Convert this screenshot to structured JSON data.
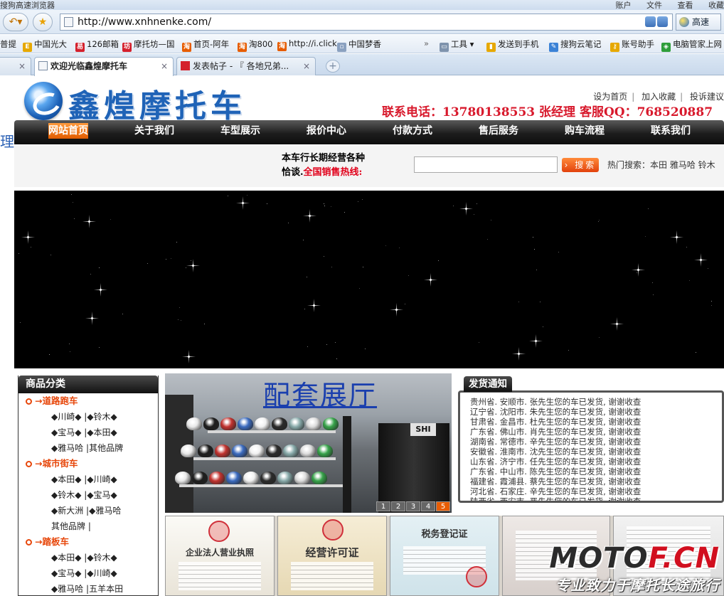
{
  "browser": {
    "title": "搜狗高速浏览器",
    "menu": [
      "账户",
      "文件",
      "查看",
      "收藏"
    ],
    "address": "http://www.xnhnenke.com/",
    "fast_label": "高速",
    "bookmarks": [
      "普提",
      "中国光大",
      "126邮箱",
      "摩托坊—国",
      "首页-阿年",
      "淘800",
      "http://i.click",
      "中国梦香"
    ],
    "bookmarks_right": [
      "工具",
      "发送到手机",
      "搜狗云笔记",
      "账号助手",
      "电脑管家上网"
    ],
    "tabs": [
      {
        "label": "欢迎光临鑫煌摩托车"
      },
      {
        "label": "发表帖子 - 『 各地兄弟..."
      }
    ]
  },
  "site": {
    "logo_text": "鑫煌摩托车",
    "toplinks": [
      "设为首页",
      "加入收藏",
      "投诉建议"
    ],
    "contact": "联系电话：13780138553 张经理 客服QQ：768520887",
    "side_char": "理",
    "nav": [
      "网站首页",
      "关于我们",
      "车型展示",
      "报价中心",
      "付款方式",
      "售后服务",
      "购车流程",
      "联系我们"
    ],
    "scroll_line1": "本车行长期经营各种",
    "scroll_line2a": "恰谈.",
    "scroll_line2b": "全国销售热线:",
    "search_button": "搜索",
    "hot_search": "热门搜索：本田  雅马哈  铃木"
  },
  "categories": {
    "title": "商品分类",
    "groups": [
      {
        "name": "→道路跑车",
        "rows": [
          "◆川崎◆ |◆铃木◆",
          "◆宝马◆ |◆本田◆",
          "◆雅马哈 |其他品牌"
        ]
      },
      {
        "name": "→城市街车",
        "rows": [
          "◆本田◆ |◆川崎◆",
          "◆铃木◆ |◆宝马◆",
          "◆新大洲 |◆雅马哈",
          "其他品牌 |"
        ]
      },
      {
        "name": "→踏板车",
        "rows": [
          "◆本田◆ |◆铃木◆",
          "◆宝马◆ |◆川崎◆",
          "◆雅马哈 |五羊本田"
        ]
      }
    ]
  },
  "showroom": {
    "title": "配套展厅",
    "pages": [
      "1",
      "2",
      "3",
      "4",
      "5"
    ],
    "active_page": "5"
  },
  "shipping": {
    "title": "发货通知",
    "items": [
      "贵州省. 安顺市. 张先生您的车已发货, 谢谢收查",
      "辽宁省. 沈阳市. 朱先生您的车已发货, 谢谢收查",
      "甘肃省. 金昌市. 杜先生您的车已发货, 谢谢收查",
      "广东省. 佛山市. 肖先生您的车已发货, 谢谢收查",
      "湖南省. 常德市. 辛先生您的车已发货, 谢谢收查",
      "安徽省. 淮南市. 沈先生您的车已发货, 谢谢收查",
      "山东省. 济宁市. 任先生您的车已发货, 谢谢收查",
      "广东省. 中山市. 陈先生您的车已发货, 谢谢收查",
      "福建省. 霞浦县. 蔡先生您的车已发货, 谢谢收查",
      "河北省. 石家庄. 辛先生您的车已发货, 谢谢收查",
      "陕西省. 西安市. 严先生您的车已发货, 谢谢收查"
    ]
  },
  "licenses": [
    "企业法人营业执照",
    "经营许可证",
    "税务登记证",
    "",
    ""
  ],
  "watermark": {
    "brand_a": "MOTO",
    "brand_b": "F.CN",
    "slogan": "专业致力于摩托长途旅行"
  }
}
